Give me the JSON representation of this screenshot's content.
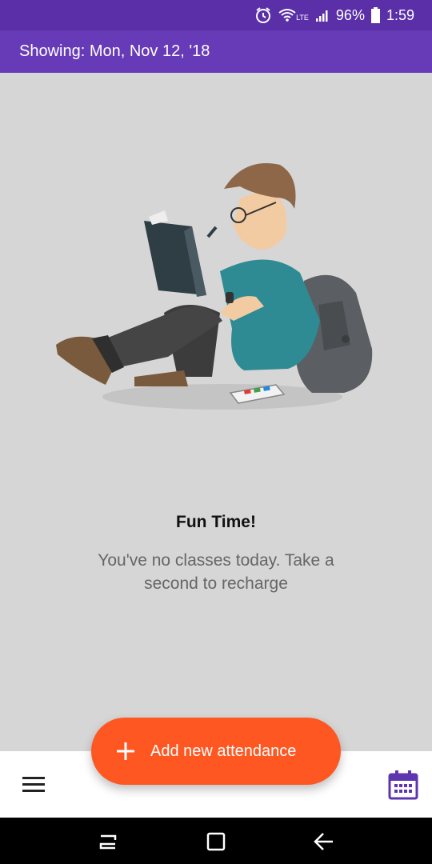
{
  "status_bar": {
    "network": "LTE",
    "battery": "96%",
    "time": "1:59",
    "icons": [
      "alarm-icon",
      "wifi-icon",
      "signal-icon",
      "battery-icon"
    ]
  },
  "app_bar": {
    "showing_label": "Showing: Mon, Nov 12, '18"
  },
  "empty_state": {
    "title": "Fun Time!",
    "message": "You've no classes today. Take a second to recharge"
  },
  "fab": {
    "label": "Add new attendance",
    "icon": "plus-icon"
  },
  "bottom_bar": {
    "menu_icon": "menu-icon",
    "calendar_icon": "calendar-icon"
  },
  "nav_bar": {
    "icons": [
      "recent-apps-icon",
      "home-icon",
      "back-icon"
    ]
  },
  "colors": {
    "status_bar": "#5a2fa8",
    "app_bar": "#673ab7",
    "background": "#d6d6d6",
    "fab": "#ff5722",
    "calendar": "#5e35b1"
  }
}
